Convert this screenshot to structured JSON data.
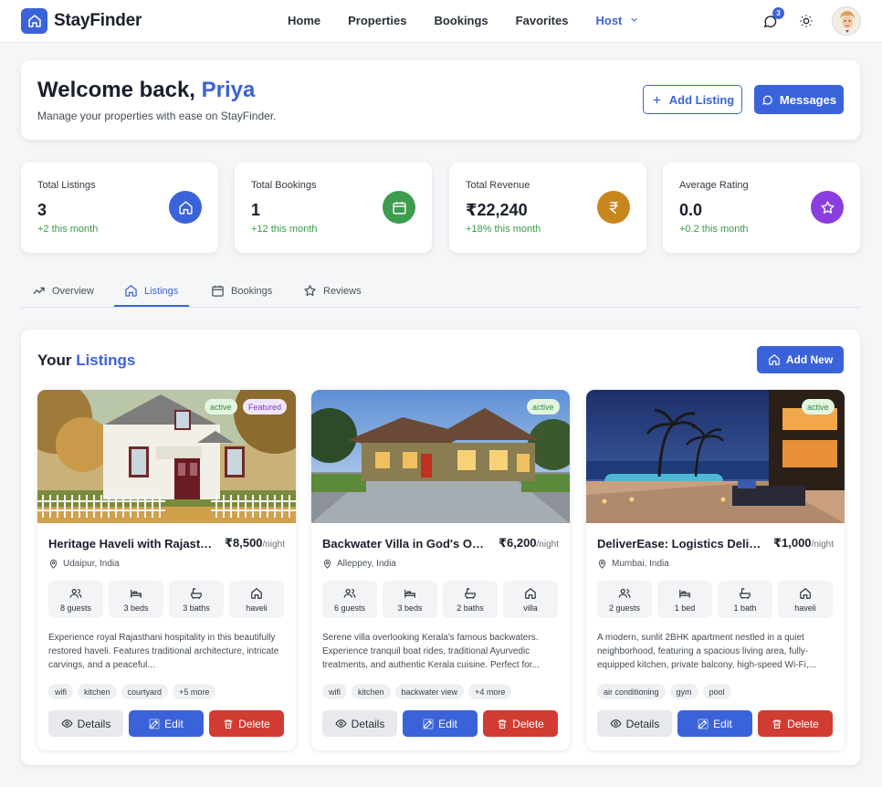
{
  "nav": {
    "brand": "StayFinder",
    "links": [
      "Home",
      "Properties",
      "Bookings",
      "Favorites"
    ],
    "host_label": "Host",
    "notification_count": "3"
  },
  "welcome": {
    "greeting": "Welcome back,",
    "name": "Priya",
    "subtitle": "Manage your properties with ease on StayFinder.",
    "add_listing_label": "Add Listing",
    "messages_label": "Messages"
  },
  "stats": [
    {
      "label": "Total Listings",
      "value": "3",
      "change": "+2 this month",
      "color": "#3b63d9"
    },
    {
      "label": "Total Bookings",
      "value": "1",
      "change": "+12 this month",
      "color": "#3e9c4f"
    },
    {
      "label": "Total Revenue",
      "value": "₹22,240",
      "change": "+18% this month",
      "color": "#c8861e"
    },
    {
      "label": "Average Rating",
      "value": "0.0",
      "change": "+0.2 this month",
      "color": "#8a3ee0"
    }
  ],
  "tabs": [
    "Overview",
    "Listings",
    "Bookings",
    "Reviews"
  ],
  "active_tab": "Listings",
  "listings_panel": {
    "title_prefix": "Your",
    "title_accent": "Listings",
    "add_new_label": "Add New"
  },
  "listings": [
    {
      "title": "Heritage Haveli with Rajasthani Charm",
      "price": "₹8,500",
      "per": "/night",
      "location": "Udaipur, India",
      "status": "active",
      "featured": "Featured",
      "features": [
        "8 guests",
        "3 beds",
        "3 baths",
        "haveli"
      ],
      "description": "Experience royal Rajasthani hospitality in this beautifully restored haveli. Features traditional architecture, intricate carvings, and a peaceful...",
      "tags": [
        "wifi",
        "kitchen",
        "courtyard",
        "+5 more"
      ],
      "details_label": "Details",
      "edit_label": "Edit",
      "delete_label": "Delete"
    },
    {
      "title": "Backwater Villa in God's Own Country",
      "price": "₹6,200",
      "per": "/night",
      "location": "Alleppey, India",
      "status": "active",
      "features": [
        "6 guests",
        "3 beds",
        "2 baths",
        "villa"
      ],
      "description": "Serene villa overlooking Kerala's famous backwaters. Experience tranquil boat rides, traditional Ayurvedic treatments, and authentic Kerala cuisine. Perfect for...",
      "tags": [
        "wifi",
        "kitchen",
        "backwater view",
        "+4 more"
      ],
      "details_label": "Details",
      "edit_label": "Edit",
      "delete_label": "Delete"
    },
    {
      "title": "DeliverEase: Logistics Delivery",
      "price": "₹1,000",
      "per": "/night",
      "location": "Mumbai, India",
      "status": "active",
      "features": [
        "2 guests",
        "1 bed",
        "1 bath",
        "haveli"
      ],
      "description": "A modern, sunlit 2BHK apartment nestled in a quiet neighborhood, featuring a spacious living area, fully-equipped kitchen, private balcony, high-speed Wi-Fi,...",
      "tags": [
        "air conditioning",
        "gym",
        "pool"
      ],
      "details_label": "Details",
      "edit_label": "Edit",
      "delete_label": "Delete"
    }
  ]
}
